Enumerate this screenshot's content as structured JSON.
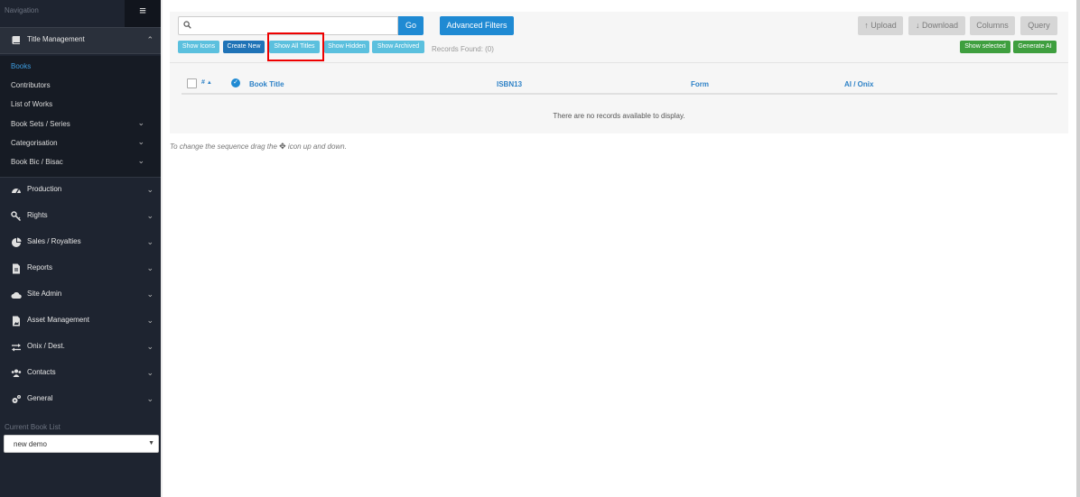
{
  "sidebar": {
    "nav_title": "Navigation",
    "hamburger": "≡",
    "title_management": "Title Management",
    "sub_items": [
      "Books",
      "Contributors",
      "List of Works",
      "Book Sets / Series",
      "Categorisation",
      "Book Bic / Bisac"
    ],
    "sections": [
      "Production",
      "Rights",
      "Sales / Royalties",
      "Reports",
      "Site Admin",
      "Asset Management",
      "Onix / Dest.",
      "Contacts",
      "General"
    ],
    "current_label": "Current Book List",
    "current_value": "new demo",
    "active_item": "Books"
  },
  "toolbar": {
    "search_placeholder": "",
    "go": "Go",
    "advanced_filters": "Advanced Filters",
    "upload": "↑ Upload",
    "download": "↓ Download",
    "columns": "Columns",
    "query": "Query",
    "show_icons": "Show Icons",
    "create_new": "Create New",
    "show_all_titles": "Show All Titles",
    "show_hidden": "Show Hidden",
    "show_archived": "Show Archived",
    "records_found": "Records Found: (0)",
    "show_selected": "Show selected",
    "generate_ai": "Generate AI"
  },
  "table": {
    "col_hash": "#",
    "sort_arrow": "▲",
    "col_book_title": "Book Title",
    "col_isbn": "ISBN13",
    "col_form": "Form",
    "col_ai": "AI / Onix",
    "empty_message": "There are no records available to display."
  },
  "hint": {
    "before": "To change the sequence drag the ",
    "after": " icon up and down."
  },
  "colors": {
    "sidebar_bg": "#1e2430",
    "primary": "#1f8ad3",
    "info": "#5bc0de",
    "success": "#3f9f3f",
    "highlight": "#e00000"
  }
}
